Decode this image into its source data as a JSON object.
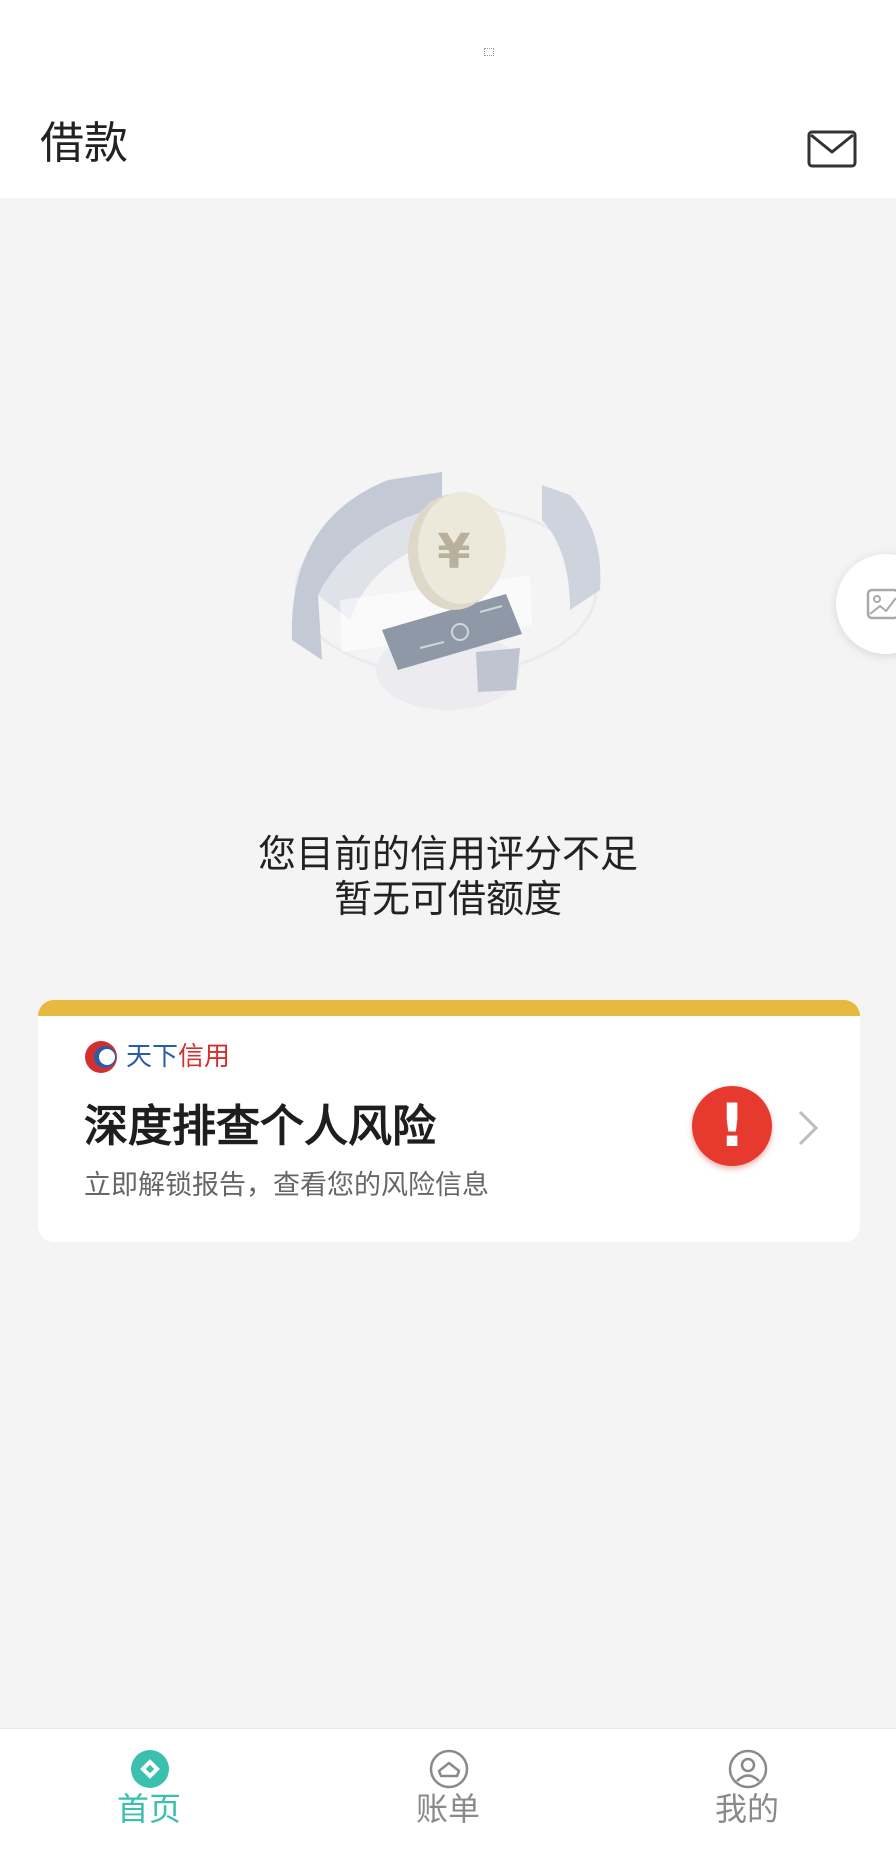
{
  "header": {
    "title": "借款"
  },
  "empty_state": {
    "line1": "您目前的信用评分不足",
    "line2": "暂无可借额度"
  },
  "promo_card": {
    "brand_part1": "天下",
    "brand_part2": "信用",
    "title": "深度排查个人风险",
    "subtitle": "立即解锁报告，查看您的风险信息",
    "alert_symbol": "!"
  },
  "tabbar": {
    "items": [
      {
        "label": "首页",
        "icon": "home-diamond-icon",
        "active": true
      },
      {
        "label": "账单",
        "icon": "bill-icon",
        "active": false
      },
      {
        "label": "我的",
        "icon": "profile-icon",
        "active": false
      }
    ]
  },
  "colors": {
    "accent": "#3bbfae",
    "card_bar": "#e8b940",
    "alert": "#e63a2e",
    "brand_blue": "#2a5ca8",
    "brand_red": "#d2302f"
  }
}
